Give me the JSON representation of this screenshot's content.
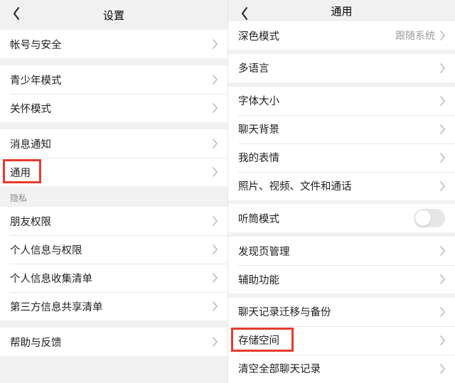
{
  "left": {
    "title": "设置",
    "items_a": [
      {
        "label": "帐号与安全"
      }
    ],
    "items_b": [
      {
        "label": "青少年模式"
      },
      {
        "label": "关怀模式"
      }
    ],
    "items_c": [
      {
        "label": "消息通知"
      },
      {
        "label": "通用"
      }
    ],
    "privacy_label": "隐私",
    "items_d": [
      {
        "label": "朋友权限"
      },
      {
        "label": "个人信息与权限"
      },
      {
        "label": "个人信息收集清单"
      },
      {
        "label": "第三方信息共享清单"
      }
    ],
    "items_e": [
      {
        "label": "帮助与反馈"
      }
    ],
    "highlighted": "通用"
  },
  "right": {
    "title": "通用",
    "items_a": [
      {
        "label": "深色模式",
        "value": "跟随系统"
      }
    ],
    "items_b": [
      {
        "label": "多语言"
      }
    ],
    "items_c": [
      {
        "label": "字体大小"
      },
      {
        "label": "聊天背景"
      },
      {
        "label": "我的表情"
      },
      {
        "label": "照片、视频、文件和通话"
      }
    ],
    "items_d": [
      {
        "label": "听筒模式",
        "toggle": false
      }
    ],
    "items_e": [
      {
        "label": "发现页管理"
      },
      {
        "label": "辅助功能"
      }
    ],
    "items_f": [
      {
        "label": "聊天记录迁移与备份"
      },
      {
        "label": "存储空间"
      },
      {
        "label": "清空全部聊天记录"
      }
    ],
    "highlighted": "存储空间"
  }
}
